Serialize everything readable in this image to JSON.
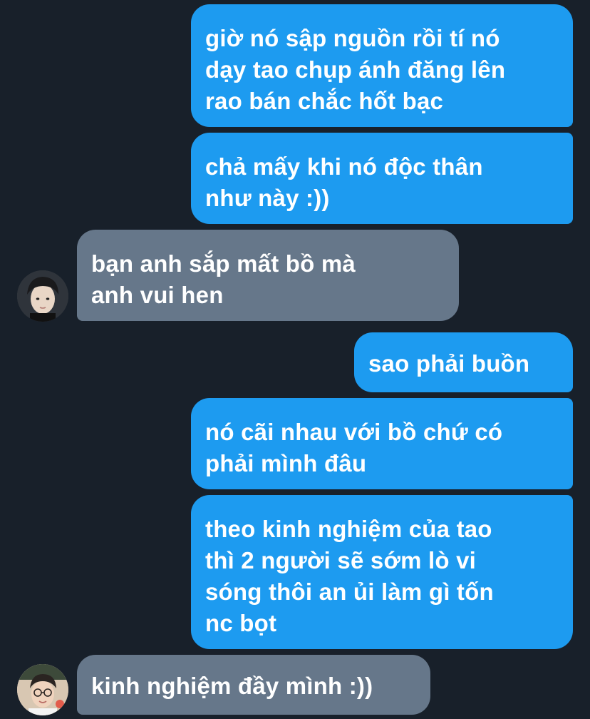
{
  "conversation": {
    "messages": [
      {
        "direction": "outgoing",
        "lines": [
          "giờ nó sập nguồn rồi tí nó",
          "dạy tao chụp ánh đăng lên",
          "rao bán chắc hốt bạc"
        ]
      },
      {
        "direction": "outgoing",
        "lines": [
          "chả mấy khi nó độc thân",
          "như này :))"
        ]
      },
      {
        "direction": "incoming",
        "lines": [
          "bạn anh sắp mất bồ mà",
          "anh vui hen"
        ],
        "avatar": "avatar-photo-1"
      },
      {
        "direction": "outgoing",
        "lines": [
          "sao phải buồn"
        ]
      },
      {
        "direction": "outgoing",
        "lines": [
          "nó cãi nhau với bồ chứ có",
          "phải mình đâu"
        ]
      },
      {
        "direction": "outgoing",
        "lines": [
          "theo kinh nghiệm của tao",
          "thì 2 người sẽ sớm lò vi",
          "sóng thôi an ủi làm gì tốn",
          "nc bọt"
        ]
      },
      {
        "direction": "incoming",
        "lines": [
          "kinh nghiệm đầy mình :))"
        ],
        "avatar": "avatar-photo-2"
      }
    ]
  },
  "colors": {
    "background": "#18202a",
    "outgoing_bubble": "#1d9bf0",
    "incoming_bubble": "#66778a",
    "text": "#ffffff"
  }
}
